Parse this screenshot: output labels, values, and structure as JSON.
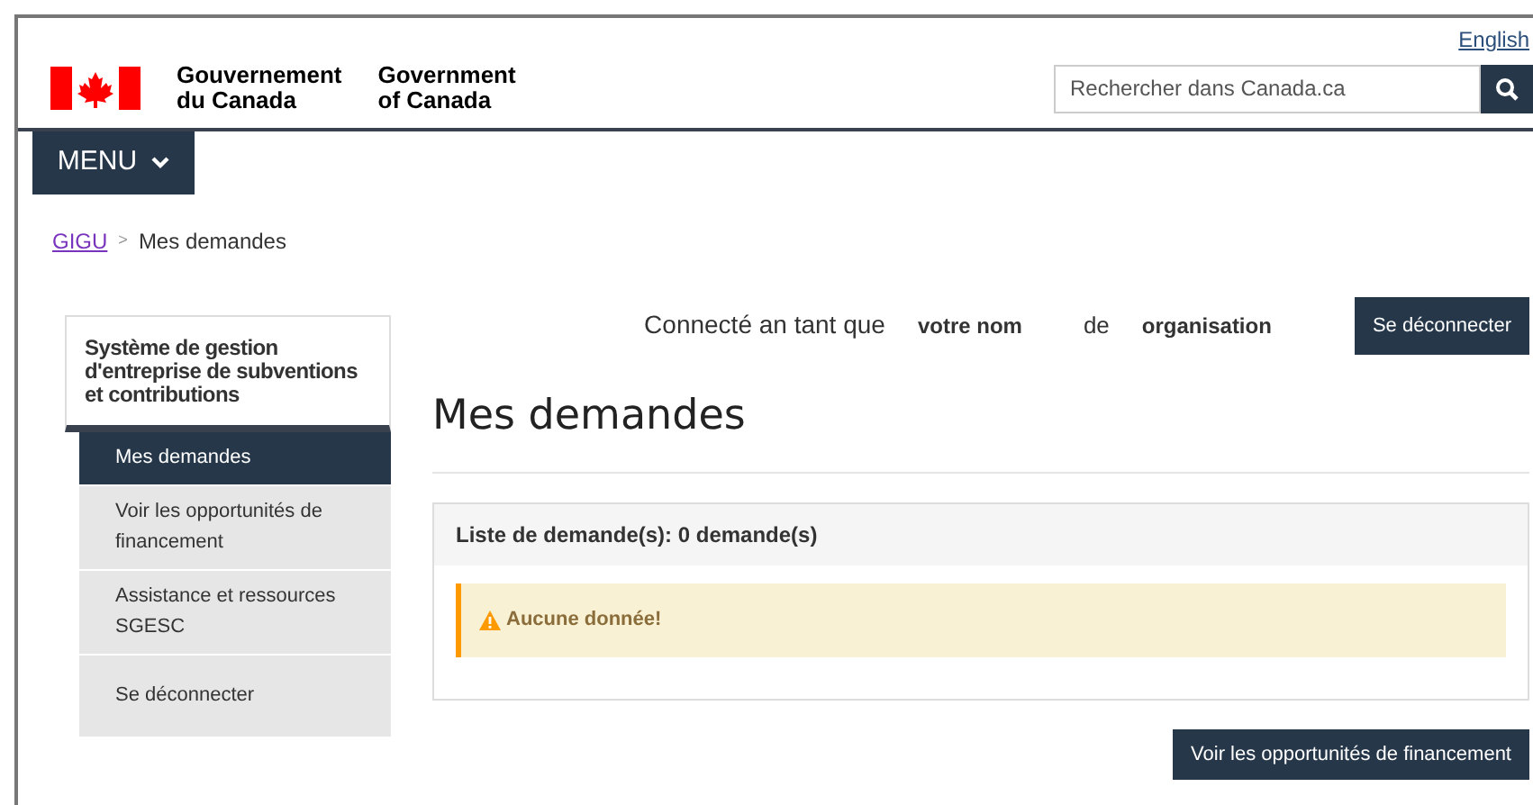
{
  "header": {
    "language_link": "English",
    "brand_fr": [
      "Gouvernement",
      "du Canada"
    ],
    "brand_en": [
      "Government",
      "of Canada"
    ],
    "search": {
      "placeholder": "Rechercher dans Canada.ca"
    }
  },
  "menu_button": "MENU",
  "breadcrumb": [
    {
      "label": "GIGU",
      "kind": "link"
    },
    {
      "label": ">",
      "kind": "separator"
    },
    {
      "label": "Mes demandes",
      "kind": "current"
    }
  ],
  "sidebar": {
    "title": "Système de gestion d'entreprise de subventions et contributions",
    "items": [
      {
        "label": "Mes demandes",
        "selected": true
      },
      {
        "label": "Voir les opportunités de financement",
        "selected": false
      },
      {
        "label": "Assistance et ressources SGESC",
        "selected": false
      },
      {
        "label": "Se déconnecter",
        "selected": false
      }
    ]
  },
  "session": {
    "prefix": "Connecté an tant que",
    "name": "votre nom",
    "joiner": "de",
    "organisation": "organisation",
    "logout_button": "Se déconnecter"
  },
  "page_title": "Mes demandes",
  "panel": {
    "heading": "Liste de demande(s): 0 demande(s)",
    "alert": "Aucune donnée!"
  },
  "action_button": "Voir les opportunités de financement"
}
